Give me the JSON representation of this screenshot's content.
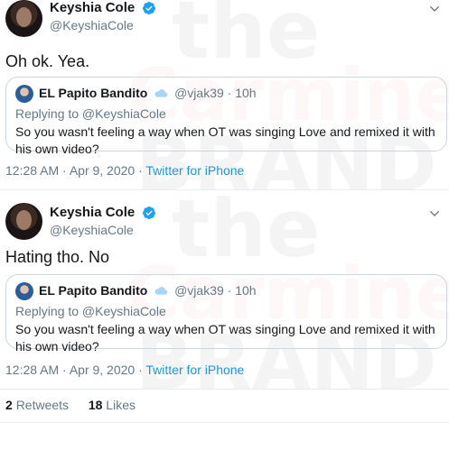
{
  "watermark": {
    "brand": "the Carmine BRAND"
  },
  "tweets": [
    {
      "author": {
        "name": "Keyshia Cole",
        "handle": "@KeyshiaCole"
      },
      "text": "Oh ok. Yea.",
      "quoted": {
        "name": "EL Papito Bandito",
        "handle": "@vjak39",
        "separator": "·",
        "time": "10h",
        "reply_to": "Replying to @KeyshiaCole",
        "text": "So you wasn't feeling a way when OT was singing Love and remixed it with his own video?"
      },
      "timestamp": "12:28 AM · Apr 9, 2020 · ",
      "source": "Twitter for iPhone"
    },
    {
      "author": {
        "name": "Keyshia Cole",
        "handle": "@KeyshiaCole"
      },
      "text": "Hating tho. No",
      "quoted": {
        "name": "EL Papito Bandito",
        "handle": "@vjak39",
        "separator": "·",
        "time": "10h",
        "reply_to": "Replying to @KeyshiaCole",
        "text": "So you wasn't feeling a way when OT was singing Love and remixed it with his own video?"
      },
      "timestamp": "12:28 AM · Apr 9, 2020 · ",
      "source": "Twitter for iPhone"
    }
  ],
  "stats": {
    "retweets_count": "2",
    "retweets_label": "Retweets",
    "likes_count": "18",
    "likes_label": "Likes"
  },
  "icons": {
    "verified": "verified-badge-icon",
    "chevron": "chevron-down-icon",
    "cloud": "cloud-emoji-icon"
  },
  "colors": {
    "verified_blue": "#1da1f2",
    "link_blue": "#1b95e0",
    "muted": "#657786",
    "text": "#14171a",
    "border": "#ccd6dd"
  }
}
